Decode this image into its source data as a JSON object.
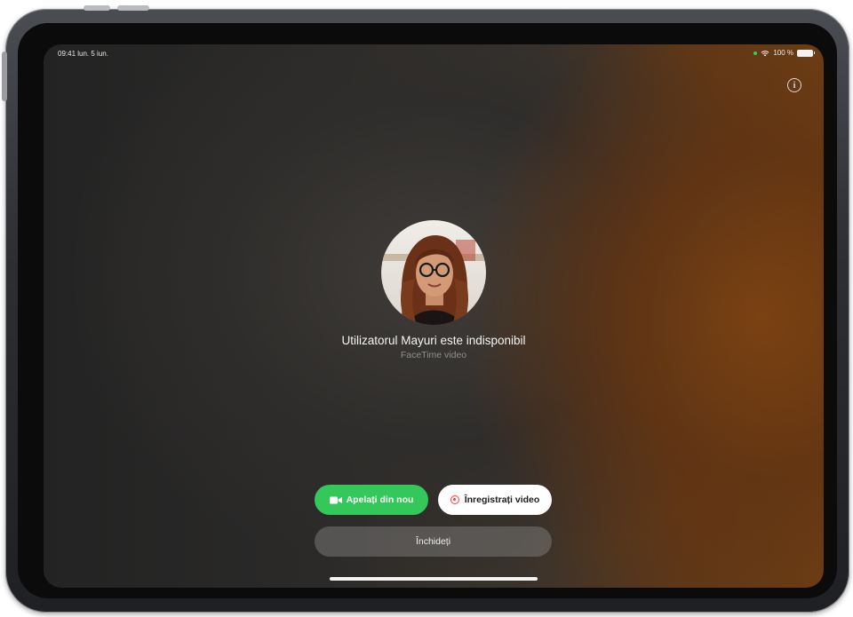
{
  "status_bar": {
    "time_date": "09:41 lun. 5 iun.",
    "battery": "100 %"
  },
  "icons": {
    "info": "info-icon",
    "video": "video-camera-icon",
    "record": "record-icon",
    "wifi": "wifi-icon",
    "battery": "battery-icon"
  },
  "call": {
    "status_text": "Utilizatorul Mayuri este indisponibil",
    "call_type": "FaceTime video"
  },
  "actions": {
    "callback_label": "Apelați din nou",
    "record_label": "Înregistrați video",
    "close_label": "Închideți"
  },
  "colors": {
    "accept_green": "#34c759",
    "record_red": "#ff3b30",
    "warm_bg": "#6f3f14"
  }
}
